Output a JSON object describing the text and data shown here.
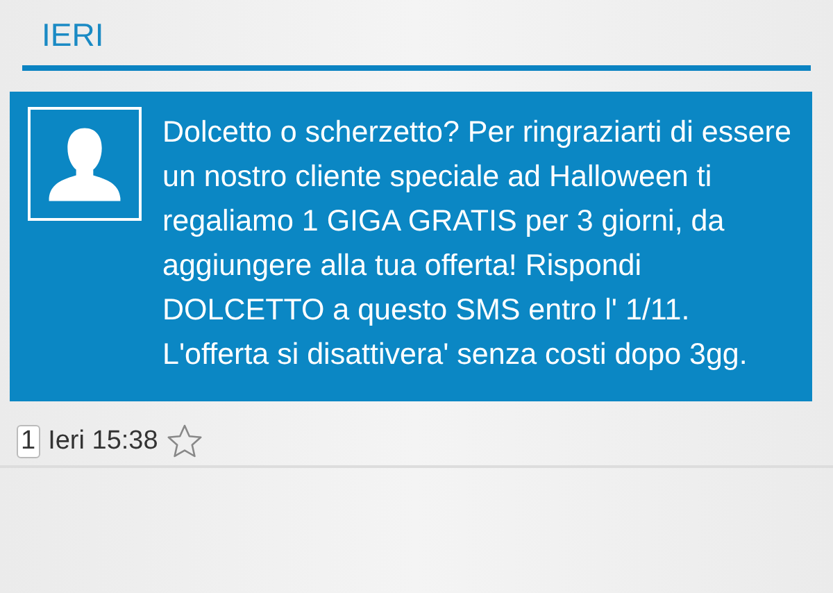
{
  "section_header": "IERI",
  "message": {
    "text": "Dolcetto o scherzetto? Per ringraziarti di essere un nostro cliente speciale ad Halloween ti regaliamo 1 GIGA GRATIS per 3 giorni, da aggiungere alla tua offerta! Rispondi DOLCETTO a questo SMS entro l' 1/11. L'offerta si disattivera' senza costi dopo 3gg.",
    "sim_slot": "1",
    "time": "Ieri 15:38",
    "starred": false
  }
}
